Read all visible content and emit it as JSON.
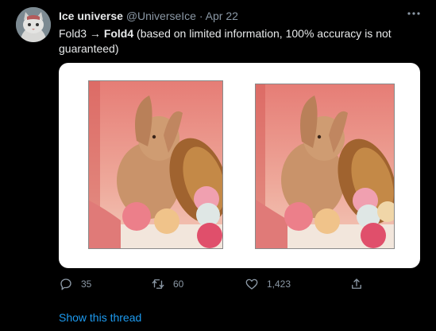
{
  "author": {
    "name": "Ice universe",
    "handle": "@UniverseIce",
    "date": "Apr 22"
  },
  "tweet": {
    "from": "Fold3",
    "arrow": "→",
    "to": "Fold4",
    "rest": "(based on limited information, 100% accuracy is not guaranteed)"
  },
  "media": {
    "alt_left": "Fold3 wallpaper: rabbit with Easter eggs and basket",
    "alt_right": "Fold4 wallpaper: rabbit with Easter eggs and basket"
  },
  "actions": {
    "replies": "35",
    "retweets": "60",
    "likes": "1,423"
  },
  "show_thread": "Show this thread",
  "colors": {
    "background": "#000000",
    "text": "#e7e9ea",
    "secondary": "#8b98a5",
    "link": "#1d9bf0"
  },
  "icons": [
    "more-icon",
    "reply-icon",
    "retweet-icon",
    "like-icon",
    "share-icon"
  ]
}
